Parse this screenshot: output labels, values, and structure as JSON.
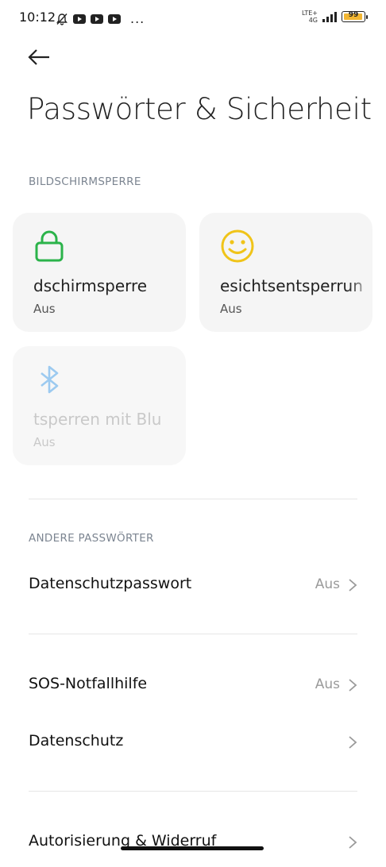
{
  "status_bar": {
    "time": "10:12",
    "network": "LTE+",
    "network_sub": "4G",
    "battery": "99",
    "more": "..."
  },
  "page": {
    "title": "Passwörter & Sicherheit"
  },
  "sections": {
    "screen_lock_header": "BILDSCHIRMSPERRE",
    "other_passwords_header": "ANDERE PASSWÖRTER"
  },
  "cards": [
    {
      "label": "Bildschirmsperre",
      "visible_label": "dschirmsperre",
      "status": "Aus",
      "icon": "lock-icon",
      "color": "#2bb34a"
    },
    {
      "label": "Gesichtsentsperrung",
      "visible_label": "esichtsentsperrun",
      "status": "Aus",
      "icon": "smiley-icon",
      "color": "#f0c419"
    },
    {
      "label": "Entsperren mit Bluetooth",
      "visible_label": "tsperren mit Blu",
      "status": "Aus",
      "icon": "bluetooth-icon",
      "color": "#9ccaf0"
    }
  ],
  "rows": {
    "privacy_password": {
      "label": "Datenschutzpasswort",
      "value": "Aus"
    },
    "sos": {
      "label": "SOS-Notfallhilfe",
      "value": "Aus"
    },
    "privacy": {
      "label": "Datenschutz"
    },
    "authorization": {
      "label": "Autorisierung & Widerruf"
    }
  }
}
